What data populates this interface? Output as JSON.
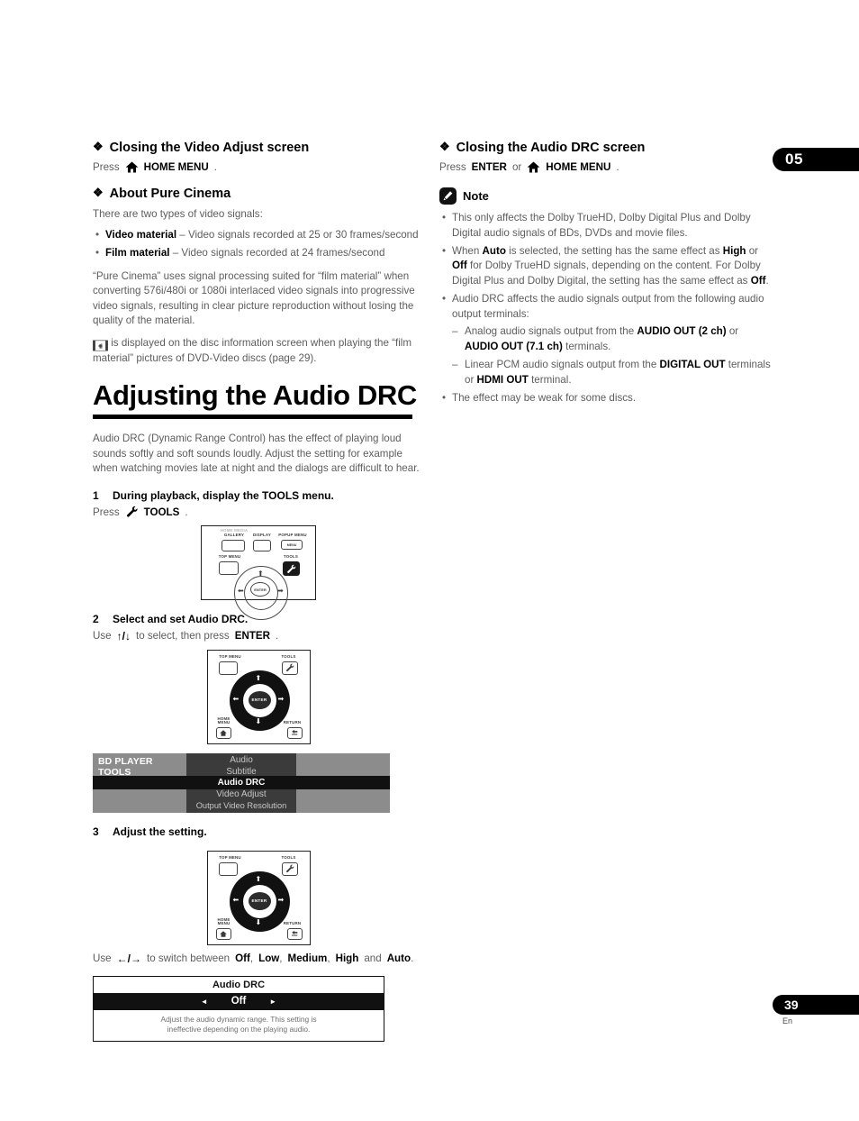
{
  "chapter_tab": "05",
  "page_tab": "39",
  "page_language": "En",
  "left": {
    "section1": {
      "heading": "Closing the Video Adjust screen",
      "press_prefix": "Press",
      "home_menu_label": "HOME MENU",
      "period": "."
    },
    "section2": {
      "heading": "About Pure Cinema",
      "intro": "There are two types of video signals:",
      "bullets": [
        {
          "term": "Video material",
          "dash": " – ",
          "text": "Video signals recorded at 25 or 30 frames/second"
        },
        {
          "term": "Film material",
          "dash": " – ",
          "text": "Video signals recorded at 24 frames/second"
        }
      ],
      "para": "“Pure Cinema” uses signal processing suited for “film material” when converting 576i/480i or 1080i interlaced video signals into progressive video signals, resulting in clear picture reproduction without losing the quality of the material.",
      "film_note": " is displayed on the disc information screen when playing the “film material” pictures of DVD-Video discs (page 29)."
    },
    "title": "Adjusting the Audio DRC",
    "intro_para": "Audio DRC (Dynamic Range Control) has the effect of playing loud sounds softly and soft sounds loudly. Adjust the setting for example when watching movies late at night and the dialogs are difficult to hear.",
    "steps": [
      {
        "num": "1",
        "text": "During playback, display the TOOLS menu."
      },
      {
        "num": "2",
        "text": "Select and set Audio DRC."
      },
      {
        "num": "3",
        "text": "Adjust the setting."
      }
    ],
    "step1_press": {
      "prefix": "Press",
      "button": "TOOLS",
      "suffix": "."
    },
    "step2_use": {
      "prefix": "Use",
      "arrows": "↑/↓",
      "middle": "to select, then press",
      "button": "ENTER",
      "suffix": "."
    },
    "step3_use": {
      "prefix": "Use",
      "arrows": "←/→",
      "middle": "to switch between",
      "options": [
        "Off",
        "Low",
        "Medium",
        "High"
      ],
      "conjunction": "and",
      "last_option": "Auto",
      "suffix": "."
    },
    "remote1": {
      "keys": [
        {
          "name": "home-media-gallery-key",
          "label_top": "HOME MEDIA",
          "label": "GALLERY"
        },
        {
          "name": "display-key",
          "label": "DISPLAY"
        },
        {
          "name": "popup-menu-key",
          "label": "POPUP MENU",
          "inner_text": "MENU"
        },
        {
          "name": "top-menu-key",
          "label": "TOP MENU"
        },
        {
          "name": "tools-key",
          "label": "TOOLS",
          "highlighted": true
        }
      ],
      "enter_label": "ENTER"
    },
    "remote2": {
      "keys": [
        {
          "name": "top-menu-key",
          "label": "TOP MENU"
        },
        {
          "name": "tools-key",
          "label": "TOOLS"
        },
        {
          "name": "home-menu-key",
          "label_line1": "HOME",
          "label_line2": "MENU"
        },
        {
          "name": "return-key",
          "label": "RETURN"
        }
      ],
      "enter_label": "ENTER",
      "highlight": "updown"
    },
    "remote3": {
      "keys": [
        {
          "name": "top-menu-key",
          "label": "TOP MENU"
        },
        {
          "name": "tools-key",
          "label": "TOOLS"
        },
        {
          "name": "home-menu-key",
          "label_line1": "HOME",
          "label_line2": "MENU"
        },
        {
          "name": "return-key",
          "label": "RETURN"
        }
      ],
      "enter_label": "ENTER",
      "highlight": "leftright"
    },
    "osd_menu": {
      "title_line1": "BD PLAYER",
      "title_line2": "TOOLS",
      "items": [
        {
          "label": "Audio",
          "selected": false
        },
        {
          "label": "Subtitle",
          "selected": false
        },
        {
          "label": "Audio DRC",
          "selected": true
        },
        {
          "label": "Video Adjust",
          "selected": false
        },
        {
          "label": "Output Video Resolution",
          "selected": false
        }
      ]
    },
    "drc_dialog": {
      "title": "Audio DRC",
      "left_arrow": "◄",
      "value": "Off",
      "right_arrow": "►",
      "description_line1": "Adjust the audio dynamic range. This setting is",
      "description_line2": "ineffective depending on the playing audio."
    }
  },
  "right": {
    "heading": "Closing the Audio DRC screen",
    "press_line": {
      "prefix": "Press",
      "enter": "ENTER",
      "or": "or",
      "home_menu": "HOME MENU",
      "suffix": "."
    },
    "note_label": "Note",
    "note_bullets": [
      {
        "parts": [
          {
            "t": "This only affects the Dolby TrueHD, Dolby Digital Plus and Dolby Digital audio signals of BDs, DVDs and movie files.",
            "b": false
          }
        ]
      },
      {
        "parts": [
          {
            "t": "When ",
            "b": false
          },
          {
            "t": "Auto",
            "b": true
          },
          {
            "t": " is selected, the setting has the same effect as ",
            "b": false
          },
          {
            "t": "High",
            "b": true
          },
          {
            "t": " or ",
            "b": false
          },
          {
            "t": "Off",
            "b": true
          },
          {
            "t": " for Dolby TrueHD signals, depending on the content. For Dolby Digital Plus and Dolby Digital, the setting has the same effect as ",
            "b": false
          },
          {
            "t": "Off",
            "b": true
          },
          {
            "t": ".",
            "b": false
          }
        ]
      },
      {
        "parts": [
          {
            "t": "Audio DRC affects the audio signals output from the following audio output terminals:",
            "b": false
          }
        ],
        "sub": [
          {
            "parts": [
              {
                "t": "Analog audio signals output from the ",
                "b": false
              },
              {
                "t": "AUDIO OUT (2 ch)",
                "b": true
              },
              {
                "t": " or ",
                "b": false
              },
              {
                "t": "AUDIO OUT (7.1 ch)",
                "b": true
              },
              {
                "t": " terminals.",
                "b": false
              }
            ]
          },
          {
            "parts": [
              {
                "t": "Linear PCM audio signals output from the ",
                "b": false
              },
              {
                "t": "DIGITAL OUT",
                "b": true
              },
              {
                "t": " terminals or ",
                "b": false
              },
              {
                "t": "HDMI OUT",
                "b": true
              },
              {
                "t": " terminal.",
                "b": false
              }
            ]
          }
        ]
      },
      {
        "parts": [
          {
            "t": "The effect may be weak for some discs.",
            "b": false
          }
        ]
      }
    ]
  },
  "colors": {
    "body_text": "#5d5d5d",
    "heading": "#000000",
    "accent_dark": "#111111",
    "osd_gray": "#8c8c8c",
    "osd_dark": "#3b3b3b"
  }
}
